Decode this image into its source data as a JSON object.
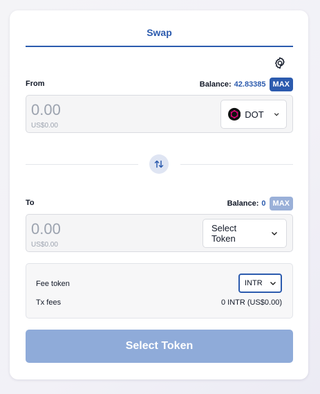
{
  "tab": {
    "title": "Swap"
  },
  "icons": {
    "settings": "gear-icon",
    "swap_direction": "swap-arrows-icon",
    "dropdown": "chevron-down-icon",
    "dot_logo": "polkadot-logo-icon"
  },
  "from": {
    "label": "From",
    "balance_label": "Balance:",
    "balance_value": "42.83385",
    "max_label": "MAX",
    "amount_placeholder": "0.00",
    "usd_value": "US$0.00",
    "token": "DOT"
  },
  "to": {
    "label": "To",
    "balance_label": "Balance:",
    "balance_value": "0",
    "max_label": "MAX",
    "amount_placeholder": "0.00",
    "usd_value": "US$0.00",
    "token": "Select Token"
  },
  "fees": {
    "fee_token_label": "Fee token",
    "fee_token_value": "INTR",
    "tx_fees_label": "Tx fees",
    "tx_fees_value": "0 INTR (US$0.00)"
  },
  "submit": {
    "label": "Select Token"
  },
  "colors": {
    "accent": "#2c5bae",
    "accent_disabled": "#8fabd9",
    "dot_brand": "#e6007a"
  }
}
